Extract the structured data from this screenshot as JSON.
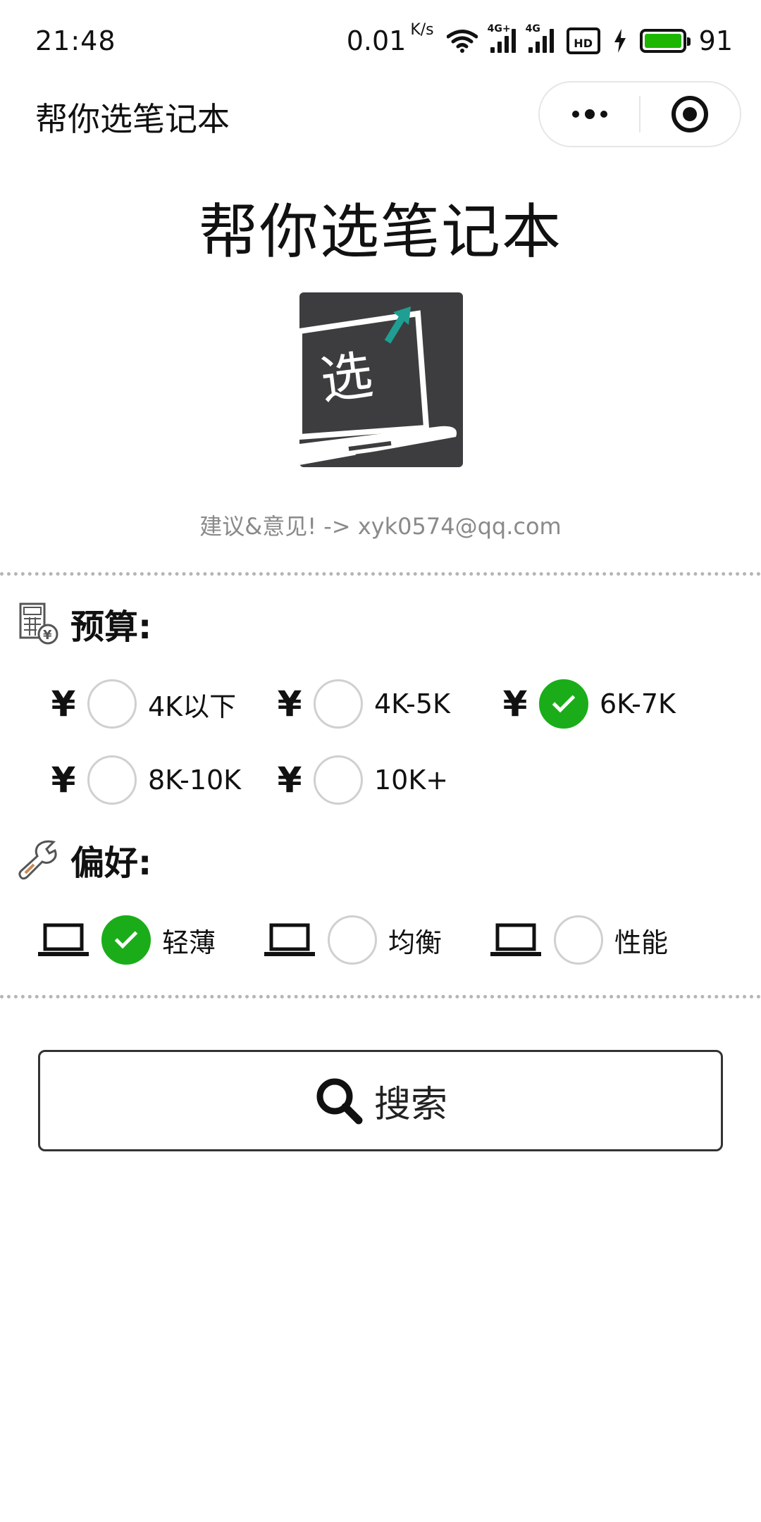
{
  "status_bar": {
    "time": "21:48",
    "net_speed": "0.01",
    "net_unit": "K/s",
    "sim1_label": "4G+",
    "sim2_label": "4G",
    "hd_label": "HD",
    "battery_level": "91",
    "battery_color": "#1db600"
  },
  "nav": {
    "title": "帮你选笔记本"
  },
  "header": {
    "title": "帮你选笔记本",
    "logo_char": "选",
    "contact": "建议&意见! -> xyk0574@qq.com"
  },
  "budget": {
    "label": "预算:",
    "currency": "¥",
    "options": [
      {
        "label": "4K以下",
        "checked": false
      },
      {
        "label": "4K-5K",
        "checked": false
      },
      {
        "label": "6K-7K",
        "checked": true
      },
      {
        "label": "8K-10K",
        "checked": false
      },
      {
        "label": "10K+",
        "checked": false
      }
    ]
  },
  "preference": {
    "label": "偏好:",
    "options": [
      {
        "label": "轻薄",
        "checked": true
      },
      {
        "label": "均衡",
        "checked": false
      },
      {
        "label": "性能",
        "checked": false
      }
    ]
  },
  "search": {
    "label": "搜索"
  },
  "colors": {
    "accent": "#1aad19",
    "logo_bg": "#3d3d3f",
    "arrow": "#1f9e93"
  }
}
